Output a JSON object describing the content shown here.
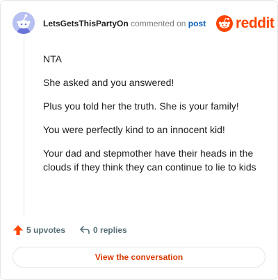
{
  "comment": {
    "author": "LetsGetsThisPartyOn",
    "commented_on_text": "commented on",
    "post_link": "post",
    "paragraphs": [
      "NTA",
      "She asked and you answered!",
      "Plus you told her the truth. She is your family!",
      "You were perfectly kind to an innocent kid!",
      "Your dad and stepmother have their heads in the clouds if they think they can continue to lie to kids"
    ]
  },
  "brand": {
    "wordmark": "reddit",
    "color": "#ff4500"
  },
  "actions": {
    "upvotes": "5 upvotes",
    "replies": "0 replies"
  },
  "view_button": {
    "label": "View the conversation"
  },
  "icons": {
    "avatar": "snoo-avatar-icon",
    "logo": "reddit-logo-icon",
    "upvote": "upvote-arrow-icon",
    "reply": "reply-arrow-icon"
  },
  "colors": {
    "accent": "#d93900",
    "link": "#0a5fb8",
    "muted": "#576f76",
    "upvote": "#ff4500",
    "avatar_bg": "#b8c0f2"
  }
}
